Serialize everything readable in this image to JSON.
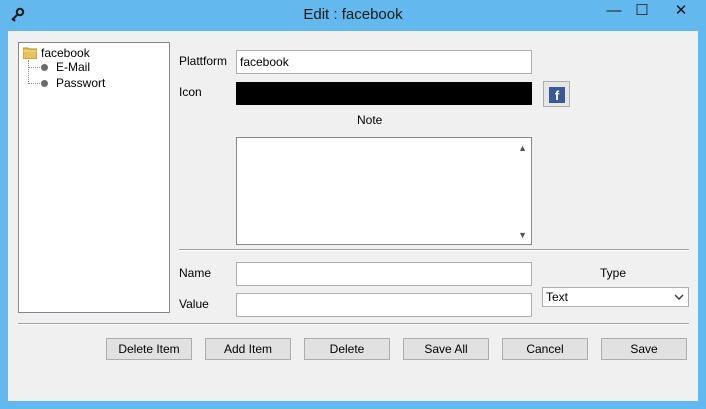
{
  "window": {
    "title": "Edit : facebook",
    "minimize": "—",
    "maximize": "☐",
    "close": "✕"
  },
  "tree": {
    "root": "facebook",
    "items": [
      {
        "label": "E-Mail"
      },
      {
        "label": "Passwort"
      }
    ]
  },
  "form": {
    "plattform_label": "Plattform",
    "plattform_value": "facebook",
    "icon_label": "Icon",
    "icon_button_glyph": "f",
    "note_label": "Note",
    "note_value": "",
    "name_label": "Name",
    "name_value": "",
    "value_label": "Value",
    "value_value": "",
    "type_label": "Type",
    "type_selected": "Text"
  },
  "buttons": {
    "delete_item": "Delete Item",
    "add_item": "Add Item",
    "delete": "Delete",
    "save_all": "Save All",
    "cancel": "Cancel",
    "save": "Save"
  },
  "colors": {
    "frame": "#63b8ee",
    "client": "#f0f0f0",
    "facebook": "#3b5998"
  },
  "icons": {
    "app": "key-icon",
    "root": "folder-icon",
    "item": "bullet-icon",
    "platform": "facebook-icon"
  }
}
